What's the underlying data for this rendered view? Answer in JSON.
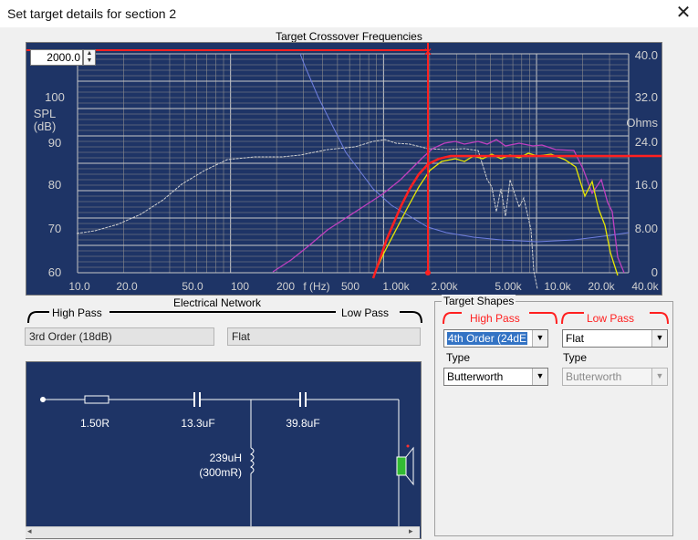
{
  "window": {
    "title": "Set target details for section 2",
    "close_label": "✕"
  },
  "graph": {
    "title": "Target Crossover Frequencies",
    "freq_value": "2000.0",
    "spl_label_1": "SPL",
    "spl_label_2": "(dB)",
    "ohms_label": "Ohms",
    "spl_ticks": [
      "100",
      "90",
      "80",
      "70",
      "60"
    ],
    "ohm_ticks": [
      "40.0",
      "32.0",
      "24.0",
      "16.0",
      "8.00",
      "0"
    ],
    "freq_ticks": [
      "10.0",
      "20.0",
      "50.0",
      "100",
      "200",
      "f (Hz)",
      "500",
      "1.00k",
      "2.00k",
      "5.00k",
      "10.0k",
      "20.0k",
      "40.0k"
    ]
  },
  "electrical": {
    "title": "Electrical Network",
    "high_pass_label": "High Pass",
    "low_pass_label": "Low Pass",
    "high_pass_value": "3rd Order (18dB)",
    "low_pass_value": "Flat"
  },
  "circuit": {
    "r1": "1.50R",
    "c1": "13.3uF",
    "c2": "39.8uF",
    "l1_value": "239uH",
    "l1_res": "(300mR)"
  },
  "target_shapes": {
    "title": "Target Shapes",
    "high_pass_label": "High Pass",
    "low_pass_label": "Low Pass",
    "hp_order": "4th Order (24dE",
    "lp_order": "Flat",
    "type_label": "Type",
    "hp_type": "Butterworth",
    "lp_type": "Butterworth"
  },
  "colors": {
    "graph_bg": "#1e3466",
    "target_curve": "#ff2020",
    "spl_curve": "#d0d0d0",
    "impedance_curve": "#6f7fe0",
    "filtered_spl": "#e0e000",
    "target_spl": "#c040c0"
  }
}
